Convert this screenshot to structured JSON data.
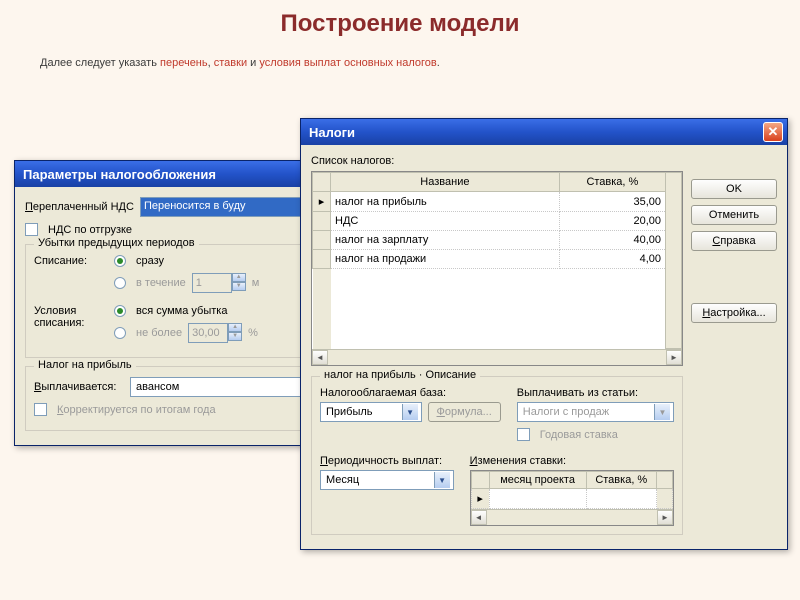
{
  "slide": {
    "title": "Построение модели",
    "sub_p1": "Далее следует указать ",
    "sub_hl1": "перечень",
    "sub_p2": ", ",
    "sub_hl2": "ставки",
    "sub_p3": " и ",
    "sub_hl3": "условия выплат основных налогов",
    "sub_p4": "."
  },
  "params": {
    "title": "Параметры налогообложения",
    "overpaid_vat_label": "Переплаченный НДС",
    "overpaid_vat_value": "Переносится в буду",
    "vat_on_shipment": "НДС по отгрузке",
    "losses_group": "Убытки предыдущих периодов",
    "writeoff_label": "Списание:",
    "writeoff_opt1": "сразу",
    "writeoff_opt2": "в течение",
    "writeoff_period": "1",
    "writeoff_unit": "м",
    "cond_label": "Условия списания:",
    "cond_opt1": "вся сумма убытка",
    "cond_opt2": "не более",
    "cond_value": "30,00",
    "cond_unit": "%",
    "profit_group": "Налог на прибыль",
    "paid_label": "Выплачивается:",
    "paid_value": "авансом",
    "adjust_year": "Корректируется по итогам года"
  },
  "taxes": {
    "title": "Налоги",
    "list_label": "Список налогов:",
    "col_name": "Название",
    "col_rate": "Ставка, %",
    "rows": [
      {
        "name": "налог на прибыль",
        "rate": "35,00"
      },
      {
        "name": "НДС",
        "rate": "20,00"
      },
      {
        "name": "налог на зарплату",
        "rate": "40,00"
      },
      {
        "name": "налог на продажи",
        "rate": "4,00"
      }
    ],
    "ok": "OK",
    "cancel": "Отменить",
    "help": "Справка",
    "settings": "Настройка...",
    "desc_group": "налог на прибыль · Описание",
    "base_label": "Налогооблагаемая база:",
    "base_value": "Прибыль",
    "formula": "Формула...",
    "pay_from_label": "Выплачивать из статьи:",
    "pay_from_value": "Налоги с продаж",
    "annual_rate": "Годовая ставка",
    "period_label": "Периодичность выплат:",
    "period_value": "Месяц",
    "changes_label": "Изменения ставки:",
    "chg_col1": "месяц проекта",
    "chg_col2": "Ставка, %"
  },
  "chart_data": {
    "type": "table",
    "title": "Список налогов",
    "columns": [
      "Название",
      "Ставка, %"
    ],
    "rows": [
      [
        "налог на прибыль",
        35.0
      ],
      [
        "НДС",
        20.0
      ],
      [
        "налог на зарплату",
        40.0
      ],
      [
        "налог на продажи",
        4.0
      ]
    ]
  }
}
